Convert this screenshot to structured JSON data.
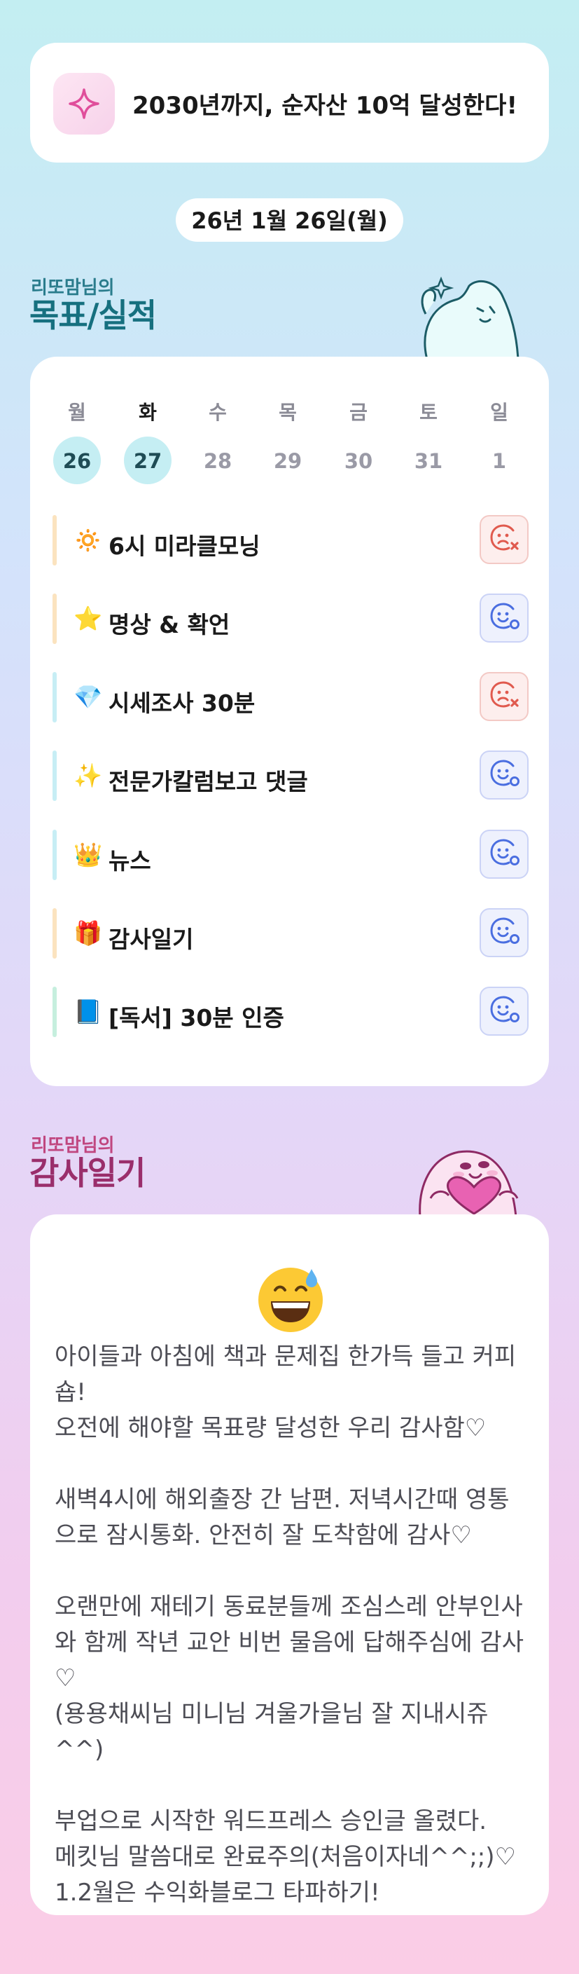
{
  "goal": {
    "icon": "sparkle-icon",
    "text": "2030년까지, 순자산 10억 달성한다!"
  },
  "date_label": "26년 1월 26일(월)",
  "goals_section": {
    "small_title": "리또맘님의",
    "big_title": "목표/실적"
  },
  "week": [
    {
      "name": "월",
      "num": "26",
      "active": true,
      "today": false
    },
    {
      "name": "화",
      "num": "27",
      "active": true,
      "today": true
    },
    {
      "name": "수",
      "num": "28",
      "active": false,
      "today": false
    },
    {
      "name": "목",
      "num": "29",
      "active": false,
      "today": false
    },
    {
      "name": "금",
      "num": "30",
      "active": false,
      "today": false
    },
    {
      "name": "토",
      "num": "31",
      "active": false,
      "today": false
    },
    {
      "name": "일",
      "num": "1",
      "active": false,
      "today": false
    }
  ],
  "habits": [
    {
      "emoji": "🔅",
      "label": "6시 미라클모닝",
      "bar_color": "#fbe3bf",
      "status": "fail"
    },
    {
      "emoji": "⭐",
      "label": "명상 & 확언",
      "bar_color": "#fbe3bf",
      "status": "ok"
    },
    {
      "emoji": "💎",
      "label": "시세조사 30분",
      "bar_color": "#c7eef5",
      "status": "fail"
    },
    {
      "emoji": "✨",
      "label": "전문가칼럼보고 댓글",
      "bar_color": "#c7eef5",
      "status": "ok"
    },
    {
      "emoji": "👑",
      "label": "뉴스",
      "bar_color": "#c7eef5",
      "status": "ok"
    },
    {
      "emoji": "🎁",
      "label": "감사일기",
      "bar_color": "#fbe3bf",
      "status": "ok"
    },
    {
      "emoji": "📘",
      "label": "[독서] 30분 인증",
      "bar_color": "#c6efde",
      "status": "ok"
    }
  ],
  "gratitude_section": {
    "small_title": "리또맘님의",
    "big_title": "감사일기"
  },
  "gratitude": {
    "mood_icon": "grinning-sweat-face-icon",
    "body": "아이들과 아침에 책과 문제집 한가득 들고 커피숍!\n오전에 해야할 목표량 달성한 우리 감사함♡\n\n새벽4시에 해외출장 간 남편. 저녁시간때 영통으로 잠시통화. 안전히 잘 도착함에 감사♡\n\n오랜만에 재테기 동료분들께 조심스레 안부인사와 함께 작년 교안 비번 물음에 답해주심에 감사♡\n(용용채씨님 미니님 겨울가을님 잘 지내시쥬^^)\n\n부업으로 시작한 워드프레스 승인글 올렸다.\n메킷님 말씀대로 완료주의(처음이자네^^;;)♡\n1.2월은 수익화블로그 타파하기!"
  },
  "colors": {
    "fail_red": "#e05a4e",
    "ok_blue": "#4a6ee0",
    "active_day": "#c5eef3",
    "teal_title": "#16707f",
    "pink_title": "#9a2e6b"
  }
}
